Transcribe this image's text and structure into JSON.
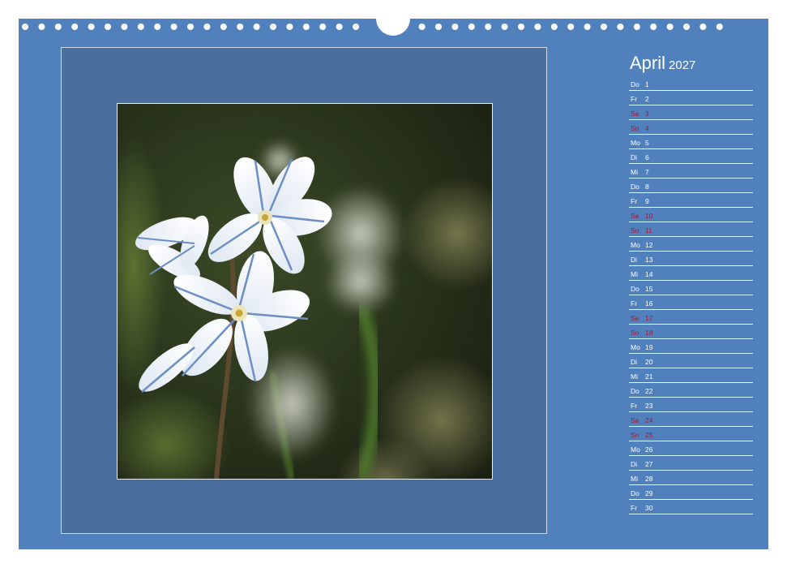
{
  "calendar": {
    "month": "April",
    "year": "2027",
    "colors": {
      "page_background": "#5181bd",
      "weekend_text": "#9e1a36",
      "weekday_text": "#ffffff"
    },
    "days": [
      {
        "name": "Do",
        "num": "1",
        "weekend": false
      },
      {
        "name": "Fr",
        "num": "2",
        "weekend": false
      },
      {
        "name": "Sa",
        "num": "3",
        "weekend": true
      },
      {
        "name": "So",
        "num": "4",
        "weekend": true
      },
      {
        "name": "Mo",
        "num": "5",
        "weekend": false
      },
      {
        "name": "Di",
        "num": "6",
        "weekend": false
      },
      {
        "name": "Mi",
        "num": "7",
        "weekend": false
      },
      {
        "name": "Do",
        "num": "8",
        "weekend": false
      },
      {
        "name": "Fr",
        "num": "9",
        "weekend": false
      },
      {
        "name": "Sa",
        "num": "10",
        "weekend": true
      },
      {
        "name": "So",
        "num": "11",
        "weekend": true
      },
      {
        "name": "Mo",
        "num": "12",
        "weekend": false
      },
      {
        "name": "Di",
        "num": "13",
        "weekend": false
      },
      {
        "name": "Mi",
        "num": "14",
        "weekend": false
      },
      {
        "name": "Do",
        "num": "15",
        "weekend": false
      },
      {
        "name": "Fr",
        "num": "16",
        "weekend": false
      },
      {
        "name": "Sa",
        "num": "17",
        "weekend": true
      },
      {
        "name": "So",
        "num": "18",
        "weekend": true
      },
      {
        "name": "Mo",
        "num": "19",
        "weekend": false
      },
      {
        "name": "Di",
        "num": "20",
        "weekend": false
      },
      {
        "name": "Mi",
        "num": "21",
        "weekend": false
      },
      {
        "name": "Do",
        "num": "22",
        "weekend": false
      },
      {
        "name": "Fr",
        "num": "23",
        "weekend": false
      },
      {
        "name": "Sa",
        "num": "24",
        "weekend": true
      },
      {
        "name": "So",
        "num": "25",
        "weekend": true
      },
      {
        "name": "Mo",
        "num": "26",
        "weekend": false
      },
      {
        "name": "Di",
        "num": "27",
        "weekend": false
      },
      {
        "name": "Mi",
        "num": "28",
        "weekend": false
      },
      {
        "name": "Do",
        "num": "29",
        "weekend": false
      },
      {
        "name": "Fr",
        "num": "30",
        "weekend": false
      }
    ]
  },
  "photo": {
    "subject_icon": "white-blue-striped-flowers-photo"
  }
}
